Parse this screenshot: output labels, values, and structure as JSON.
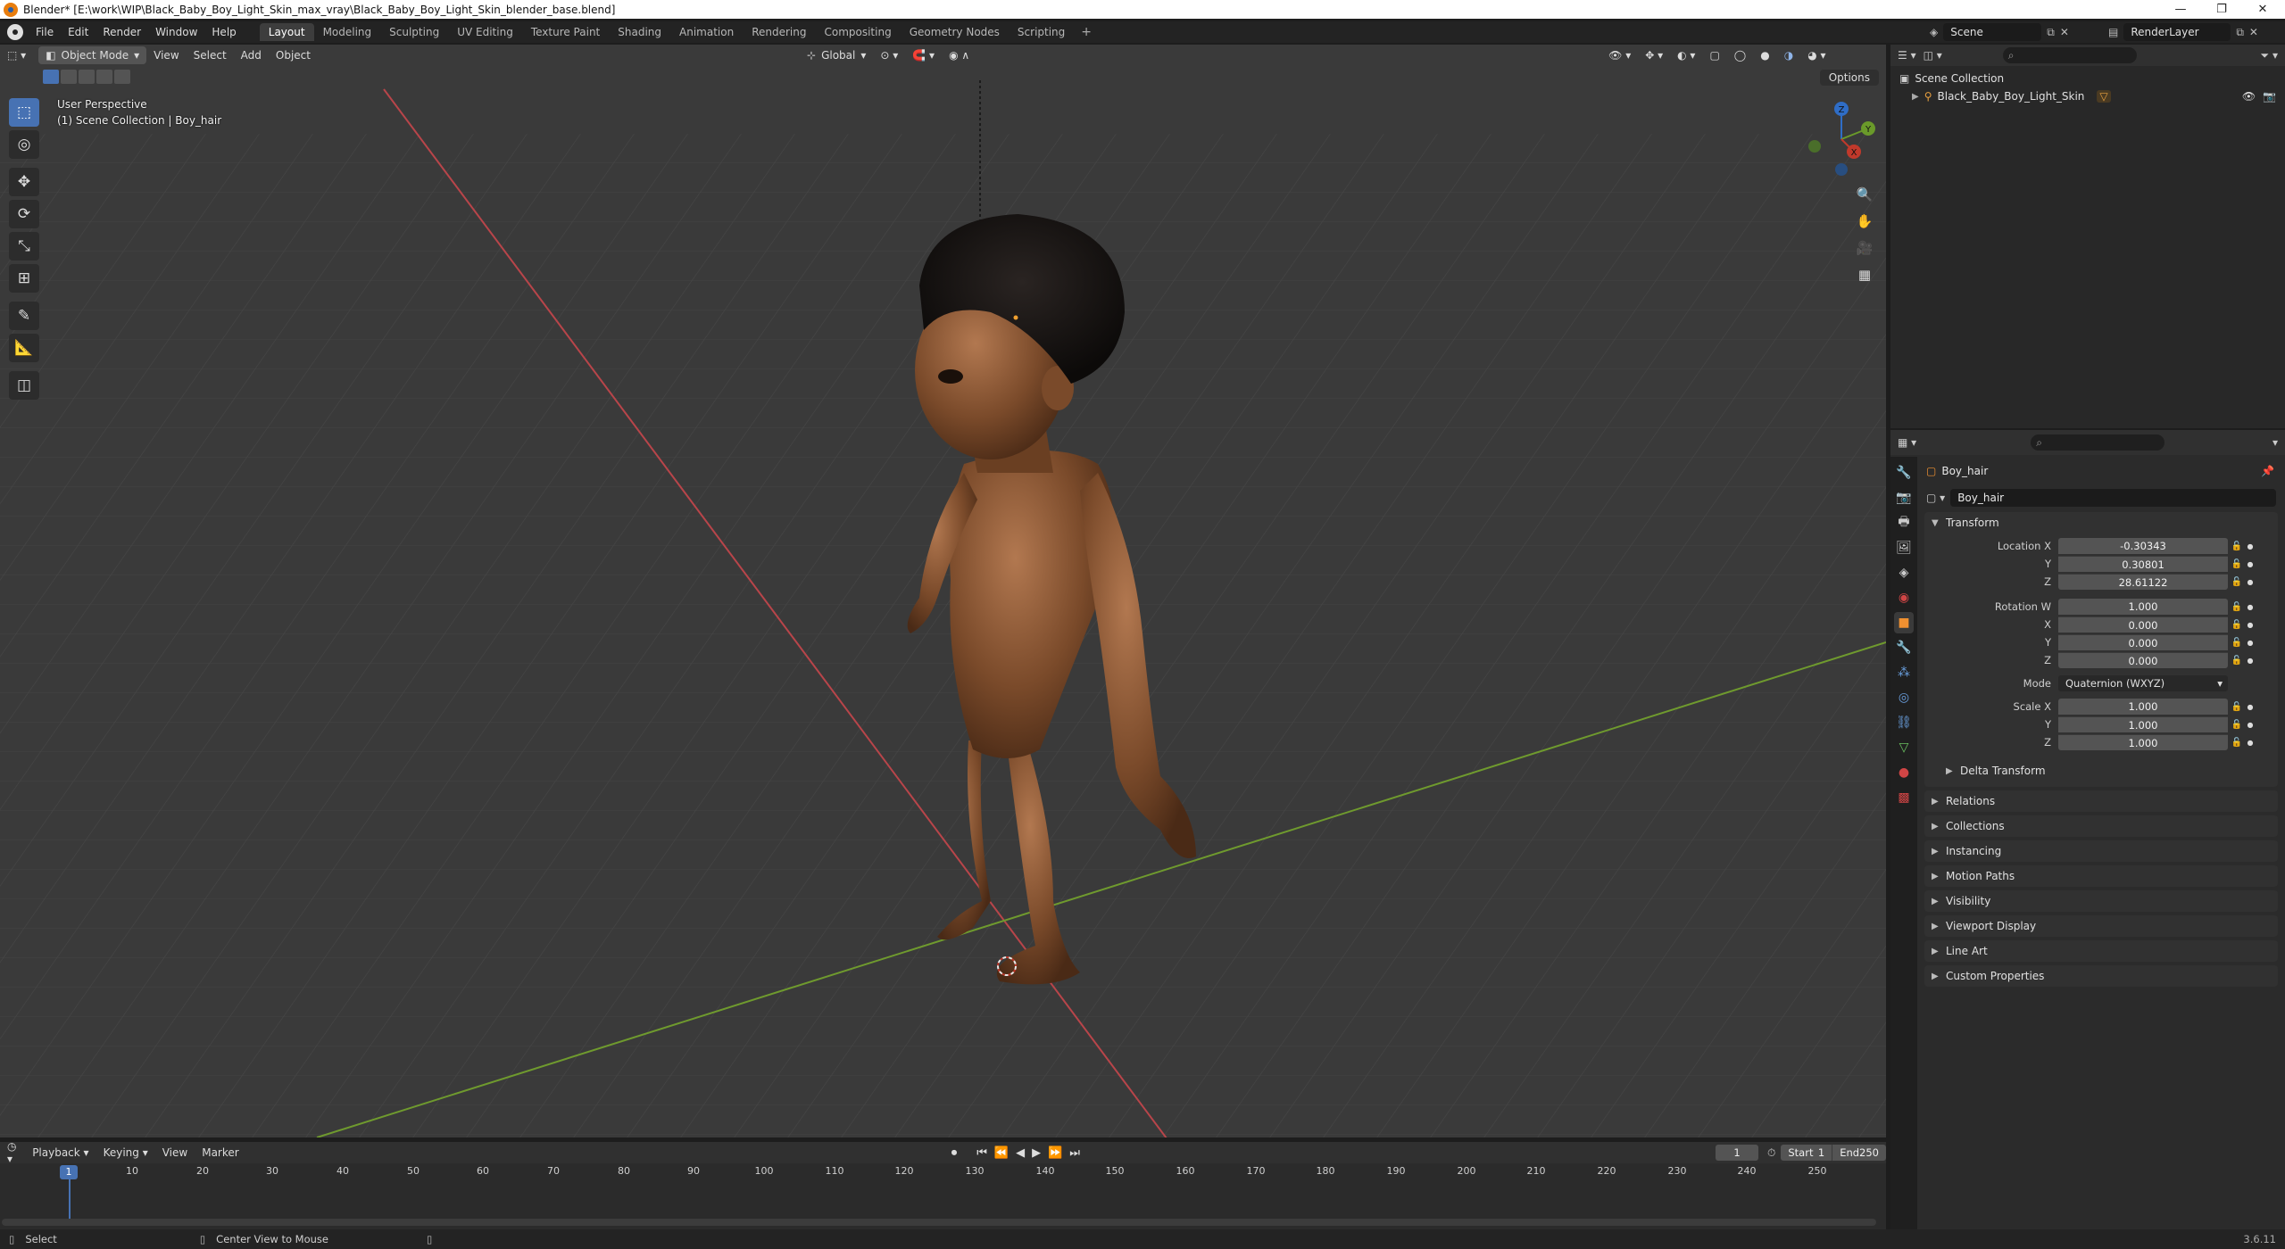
{
  "window": {
    "title": "Blender* [E:\\work\\WIP\\Black_Baby_Boy_Light_Skin_max_vray\\Black_Baby_Boy_Light_Skin_blender_base.blend]",
    "controls": [
      "—",
      "❐",
      "✕"
    ]
  },
  "menubar": {
    "items": [
      "File",
      "Edit",
      "Render",
      "Window",
      "Help"
    ],
    "workspaces": [
      "Layout",
      "Modeling",
      "Sculpting",
      "UV Editing",
      "Texture Paint",
      "Shading",
      "Animation",
      "Rendering",
      "Compositing",
      "Geometry Nodes",
      "Scripting"
    ],
    "active_workspace": "Layout",
    "add_tab": "+",
    "scene": "Scene",
    "render_layer": "RenderLayer"
  },
  "viewport": {
    "mode": "Object Mode",
    "menus": [
      "View",
      "Select",
      "Add",
      "Object"
    ],
    "transform_orientation": "Global",
    "options_label": "Options",
    "overlay_line1": "User Perspective",
    "overlay_line2": "(1) Scene Collection | Boy_hair",
    "gizmo_axes": {
      "x": "X",
      "y": "Y",
      "z": "Z"
    },
    "tools": [
      "select-box-icon",
      "cursor-icon",
      "move-icon",
      "rotate-icon",
      "scale-icon",
      "transform-icon",
      "annotate-icon",
      "measure-icon",
      "add-cube-icon"
    ],
    "nav_icons": [
      "zoom-icon",
      "hand-pan-icon",
      "camera-icon",
      "grid-icon"
    ]
  },
  "outliner": {
    "root": "Scene Collection",
    "items": [
      {
        "label": "Black_Baby_Boy_Light_Skin"
      }
    ]
  },
  "properties": {
    "object_name": "Boy_hair",
    "datablock_name": "Boy_hair",
    "transform": {
      "title": "Transform",
      "location": {
        "label": "Location X",
        "x": "-0.30343",
        "y": "0.30801",
        "z": "28.61122"
      },
      "rotation": {
        "label": "Rotation W",
        "w": "1.000",
        "x": "0.000",
        "y": "0.000",
        "z": "0.000"
      },
      "mode_label": "Mode",
      "mode_value": "Quaternion (WXYZ)",
      "scale": {
        "label": "Scale X",
        "x": "1.000",
        "y": "1.000",
        "z": "1.000"
      },
      "axis_y": "Y",
      "axis_z": "Z",
      "axis_x": "X"
    },
    "delta_transform": "Delta Transform",
    "panels": [
      "Relations",
      "Collections",
      "Instancing",
      "Motion Paths",
      "Visibility",
      "Viewport Display",
      "Line Art",
      "Custom Properties"
    ]
  },
  "timeline": {
    "menus": [
      "Playback",
      "Keying",
      "View",
      "Marker"
    ],
    "current_frame": "1",
    "start_label": "Start",
    "start": "1",
    "end_label": "End",
    "end": "250",
    "ticks": [
      "10",
      "20",
      "30",
      "40",
      "50",
      "60",
      "70",
      "80",
      "90",
      "100",
      "110",
      "120",
      "130",
      "140",
      "150",
      "160",
      "170",
      "180",
      "190",
      "200",
      "210",
      "220",
      "230",
      "240",
      "250"
    ],
    "playhead": "1"
  },
  "statusbar": {
    "left": "Select",
    "middle": "Center View to Mouse",
    "version": "3.6.11"
  },
  "colors": {
    "accent": "#4772b3",
    "x_axis": "#c0392b",
    "y_axis": "#6a9a2a",
    "z_axis": "#2f6dc6"
  }
}
